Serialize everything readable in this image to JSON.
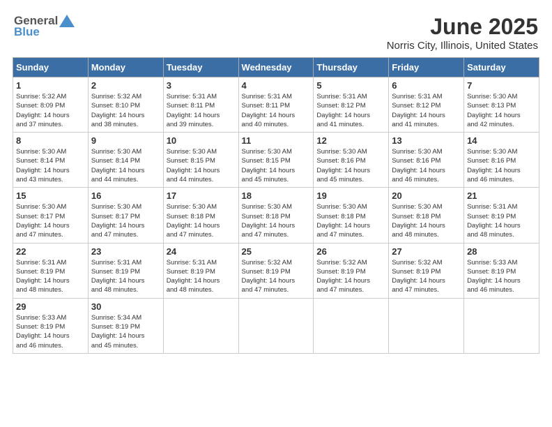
{
  "header": {
    "logo_general": "General",
    "logo_blue": "Blue",
    "month": "June 2025",
    "location": "Norris City, Illinois, United States"
  },
  "days_of_week": [
    "Sunday",
    "Monday",
    "Tuesday",
    "Wednesday",
    "Thursday",
    "Friday",
    "Saturday"
  ],
  "weeks": [
    [
      {
        "day": "1",
        "info": "Sunrise: 5:32 AM\nSunset: 8:09 PM\nDaylight: 14 hours\nand 37 minutes."
      },
      {
        "day": "2",
        "info": "Sunrise: 5:32 AM\nSunset: 8:10 PM\nDaylight: 14 hours\nand 38 minutes."
      },
      {
        "day": "3",
        "info": "Sunrise: 5:31 AM\nSunset: 8:11 PM\nDaylight: 14 hours\nand 39 minutes."
      },
      {
        "day": "4",
        "info": "Sunrise: 5:31 AM\nSunset: 8:11 PM\nDaylight: 14 hours\nand 40 minutes."
      },
      {
        "day": "5",
        "info": "Sunrise: 5:31 AM\nSunset: 8:12 PM\nDaylight: 14 hours\nand 41 minutes."
      },
      {
        "day": "6",
        "info": "Sunrise: 5:31 AM\nSunset: 8:12 PM\nDaylight: 14 hours\nand 41 minutes."
      },
      {
        "day": "7",
        "info": "Sunrise: 5:30 AM\nSunset: 8:13 PM\nDaylight: 14 hours\nand 42 minutes."
      }
    ],
    [
      {
        "day": "8",
        "info": "Sunrise: 5:30 AM\nSunset: 8:14 PM\nDaylight: 14 hours\nand 43 minutes."
      },
      {
        "day": "9",
        "info": "Sunrise: 5:30 AM\nSunset: 8:14 PM\nDaylight: 14 hours\nand 44 minutes."
      },
      {
        "day": "10",
        "info": "Sunrise: 5:30 AM\nSunset: 8:15 PM\nDaylight: 14 hours\nand 44 minutes."
      },
      {
        "day": "11",
        "info": "Sunrise: 5:30 AM\nSunset: 8:15 PM\nDaylight: 14 hours\nand 45 minutes."
      },
      {
        "day": "12",
        "info": "Sunrise: 5:30 AM\nSunset: 8:16 PM\nDaylight: 14 hours\nand 45 minutes."
      },
      {
        "day": "13",
        "info": "Sunrise: 5:30 AM\nSunset: 8:16 PM\nDaylight: 14 hours\nand 46 minutes."
      },
      {
        "day": "14",
        "info": "Sunrise: 5:30 AM\nSunset: 8:16 PM\nDaylight: 14 hours\nand 46 minutes."
      }
    ],
    [
      {
        "day": "15",
        "info": "Sunrise: 5:30 AM\nSunset: 8:17 PM\nDaylight: 14 hours\nand 47 minutes."
      },
      {
        "day": "16",
        "info": "Sunrise: 5:30 AM\nSunset: 8:17 PM\nDaylight: 14 hours\nand 47 minutes."
      },
      {
        "day": "17",
        "info": "Sunrise: 5:30 AM\nSunset: 8:18 PM\nDaylight: 14 hours\nand 47 minutes."
      },
      {
        "day": "18",
        "info": "Sunrise: 5:30 AM\nSunset: 8:18 PM\nDaylight: 14 hours\nand 47 minutes."
      },
      {
        "day": "19",
        "info": "Sunrise: 5:30 AM\nSunset: 8:18 PM\nDaylight: 14 hours\nand 47 minutes."
      },
      {
        "day": "20",
        "info": "Sunrise: 5:30 AM\nSunset: 8:18 PM\nDaylight: 14 hours\nand 48 minutes."
      },
      {
        "day": "21",
        "info": "Sunrise: 5:31 AM\nSunset: 8:19 PM\nDaylight: 14 hours\nand 48 minutes."
      }
    ],
    [
      {
        "day": "22",
        "info": "Sunrise: 5:31 AM\nSunset: 8:19 PM\nDaylight: 14 hours\nand 48 minutes."
      },
      {
        "day": "23",
        "info": "Sunrise: 5:31 AM\nSunset: 8:19 PM\nDaylight: 14 hours\nand 48 minutes."
      },
      {
        "day": "24",
        "info": "Sunrise: 5:31 AM\nSunset: 8:19 PM\nDaylight: 14 hours\nand 48 minutes."
      },
      {
        "day": "25",
        "info": "Sunrise: 5:32 AM\nSunset: 8:19 PM\nDaylight: 14 hours\nand 47 minutes."
      },
      {
        "day": "26",
        "info": "Sunrise: 5:32 AM\nSunset: 8:19 PM\nDaylight: 14 hours\nand 47 minutes."
      },
      {
        "day": "27",
        "info": "Sunrise: 5:32 AM\nSunset: 8:19 PM\nDaylight: 14 hours\nand 47 minutes."
      },
      {
        "day": "28",
        "info": "Sunrise: 5:33 AM\nSunset: 8:19 PM\nDaylight: 14 hours\nand 46 minutes."
      }
    ],
    [
      {
        "day": "29",
        "info": "Sunrise: 5:33 AM\nSunset: 8:19 PM\nDaylight: 14 hours\nand 46 minutes."
      },
      {
        "day": "30",
        "info": "Sunrise: 5:34 AM\nSunset: 8:19 PM\nDaylight: 14 hours\nand 45 minutes."
      },
      {
        "day": "",
        "info": ""
      },
      {
        "day": "",
        "info": ""
      },
      {
        "day": "",
        "info": ""
      },
      {
        "day": "",
        "info": ""
      },
      {
        "day": "",
        "info": ""
      }
    ]
  ]
}
